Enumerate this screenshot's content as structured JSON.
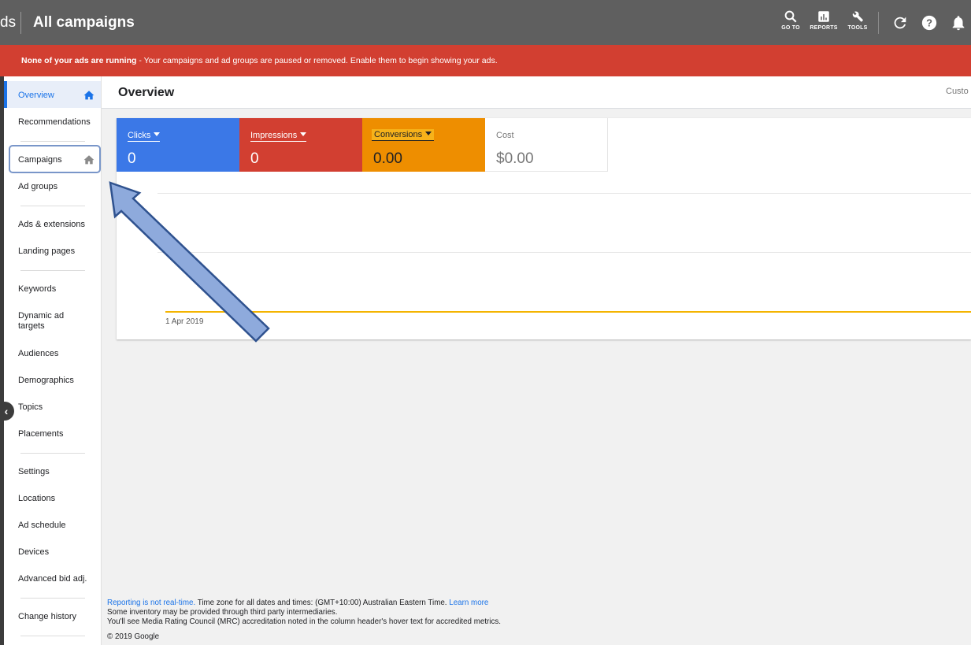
{
  "header": {
    "brand_fragment": "ds",
    "title": "All campaigns",
    "buttons": [
      {
        "label": "GO TO",
        "icon": "search-icon"
      },
      {
        "label": "REPORTS",
        "icon": "reports-icon"
      },
      {
        "label": "TOOLS",
        "icon": "wrench-icon"
      }
    ],
    "icons": [
      "refresh-icon",
      "help-icon",
      "bell-icon"
    ]
  },
  "alert": {
    "bold": "None of your ads are running",
    "text": " - Your campaigns and ad groups are paused or removed. Enable them to begin showing your ads.",
    "color": "#d23f31"
  },
  "sidebar": {
    "items": [
      {
        "label": "Overview"
      },
      {
        "label": "Recommendations"
      },
      {
        "label": "Campaigns"
      },
      {
        "label": "Ad groups"
      },
      {
        "label": "Ads & extensions"
      },
      {
        "label": "Landing pages"
      },
      {
        "label": "Keywords"
      },
      {
        "label": "Dynamic ad targets"
      },
      {
        "label": "Audiences"
      },
      {
        "label": "Demographics"
      },
      {
        "label": "Topics"
      },
      {
        "label": "Placements"
      },
      {
        "label": "Settings"
      },
      {
        "label": "Locations"
      },
      {
        "label": "Ad schedule"
      },
      {
        "label": "Devices"
      },
      {
        "label": "Advanced bid adj."
      },
      {
        "label": "Change history"
      }
    ],
    "active": "Overview",
    "accent": "#1a73e8"
  },
  "page": {
    "title": "Overview",
    "right_fragment": "Custo"
  },
  "metrics": {
    "clicks": {
      "label": "Clicks",
      "value": "0",
      "color": "#3b78e7"
    },
    "impressions": {
      "label": "Impressions",
      "value": "0",
      "color": "#d23f31"
    },
    "conversions": {
      "label": "Conversions",
      "value": "0.00",
      "color": "#ee8e00"
    },
    "cost": {
      "label": "Cost",
      "value": "$0.00"
    }
  },
  "chart": {
    "x_label": "1 Apr 2019",
    "series_color": "#f4b400"
  },
  "footer": {
    "realtime_link": "Reporting is not real-time.",
    "timezone": " Time zone for all dates and times: (GMT+10:00) Australian Eastern Time. ",
    "learn_more": "Learn more",
    "line2": "Some inventory may be provided through third party intermediaries.",
    "line3": "You'll see Media Rating Council (MRC) accreditation noted in the column header's hover text for accredited metrics.",
    "copyright": "© 2019 Google"
  }
}
